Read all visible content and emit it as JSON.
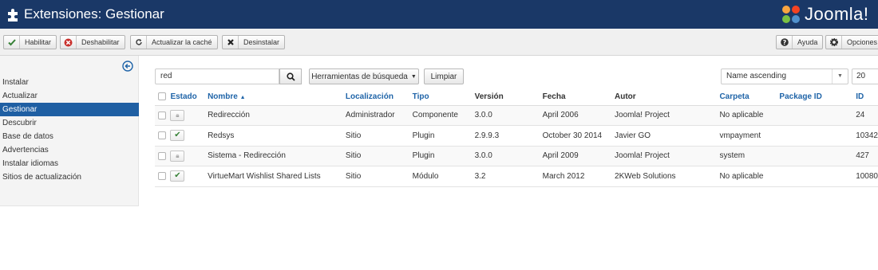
{
  "header": {
    "title": "Extensiones: Gestionar",
    "logo_text": "Joomla!"
  },
  "toolbar": {
    "enable_label": "Habilitar",
    "disable_label": "Deshabilitar",
    "refresh_label": "Actualizar la caché",
    "uninstall_label": "Desinstalar",
    "help_label": "Ayuda",
    "options_label": "Opciones"
  },
  "sidebar": {
    "items": [
      {
        "label": "Instalar"
      },
      {
        "label": "Actualizar"
      },
      {
        "label": "Gestionar"
      },
      {
        "label": "Descubrir"
      },
      {
        "label": "Base de datos"
      },
      {
        "label": "Advertencias"
      },
      {
        "label": "Instalar idiomas"
      },
      {
        "label": "Sitios de actualización"
      }
    ],
    "active": "Gestionar"
  },
  "filters": {
    "search_value": "red",
    "tools_label": "Herramientas de búsqueda",
    "clear_label": "Limpiar",
    "sort_value": "Name ascending",
    "limit_value": "20"
  },
  "table": {
    "columns": {
      "estado": "Estado",
      "nombre": "Nombre",
      "localizacion": "Localización",
      "tipo": "Tipo",
      "version": "Versión",
      "fecha": "Fecha",
      "autor": "Autor",
      "carpeta": "Carpeta",
      "package_id": "Package ID",
      "id": "ID"
    },
    "rows": [
      {
        "estado": "locked",
        "nombre": "Redirección",
        "localizacion": "Administrador",
        "tipo": "Componente",
        "version": "3.0.0",
        "fecha": "April 2006",
        "autor": "Joomla! Project",
        "carpeta": "No aplicable",
        "package_id": "",
        "id": "24"
      },
      {
        "estado": "enabled",
        "nombre": "Redsys",
        "localizacion": "Sitio",
        "tipo": "Plugin",
        "version": "2.9.9.3",
        "fecha": "October 30 2014",
        "autor": "Javier GO",
        "carpeta": "vmpayment",
        "package_id": "",
        "id": "10342"
      },
      {
        "estado": "locked",
        "nombre": "Sistema - Redirección",
        "localizacion": "Sitio",
        "tipo": "Plugin",
        "version": "3.0.0",
        "fecha": "April 2009",
        "autor": "Joomla! Project",
        "carpeta": "system",
        "package_id": "",
        "id": "427"
      },
      {
        "estado": "enabled",
        "nombre": "VirtueMart Wishlist Shared Lists",
        "localizacion": "Sitio",
        "tipo": "Módulo",
        "version": "3.2",
        "fecha": "March 2012",
        "autor": "2KWeb Solutions",
        "carpeta": "No aplicable",
        "package_id": "",
        "id": "10080"
      }
    ]
  },
  "icons": {
    "puzzle": "puzzle-icon",
    "search": "search-icon",
    "locked": "lock-icon",
    "enabled": "check-icon"
  },
  "colors": {
    "header_bg": "#1a3867",
    "active_item": "#1f5fa3",
    "link": "#1f64a8",
    "success": "#378137",
    "danger": "#c9302c"
  }
}
